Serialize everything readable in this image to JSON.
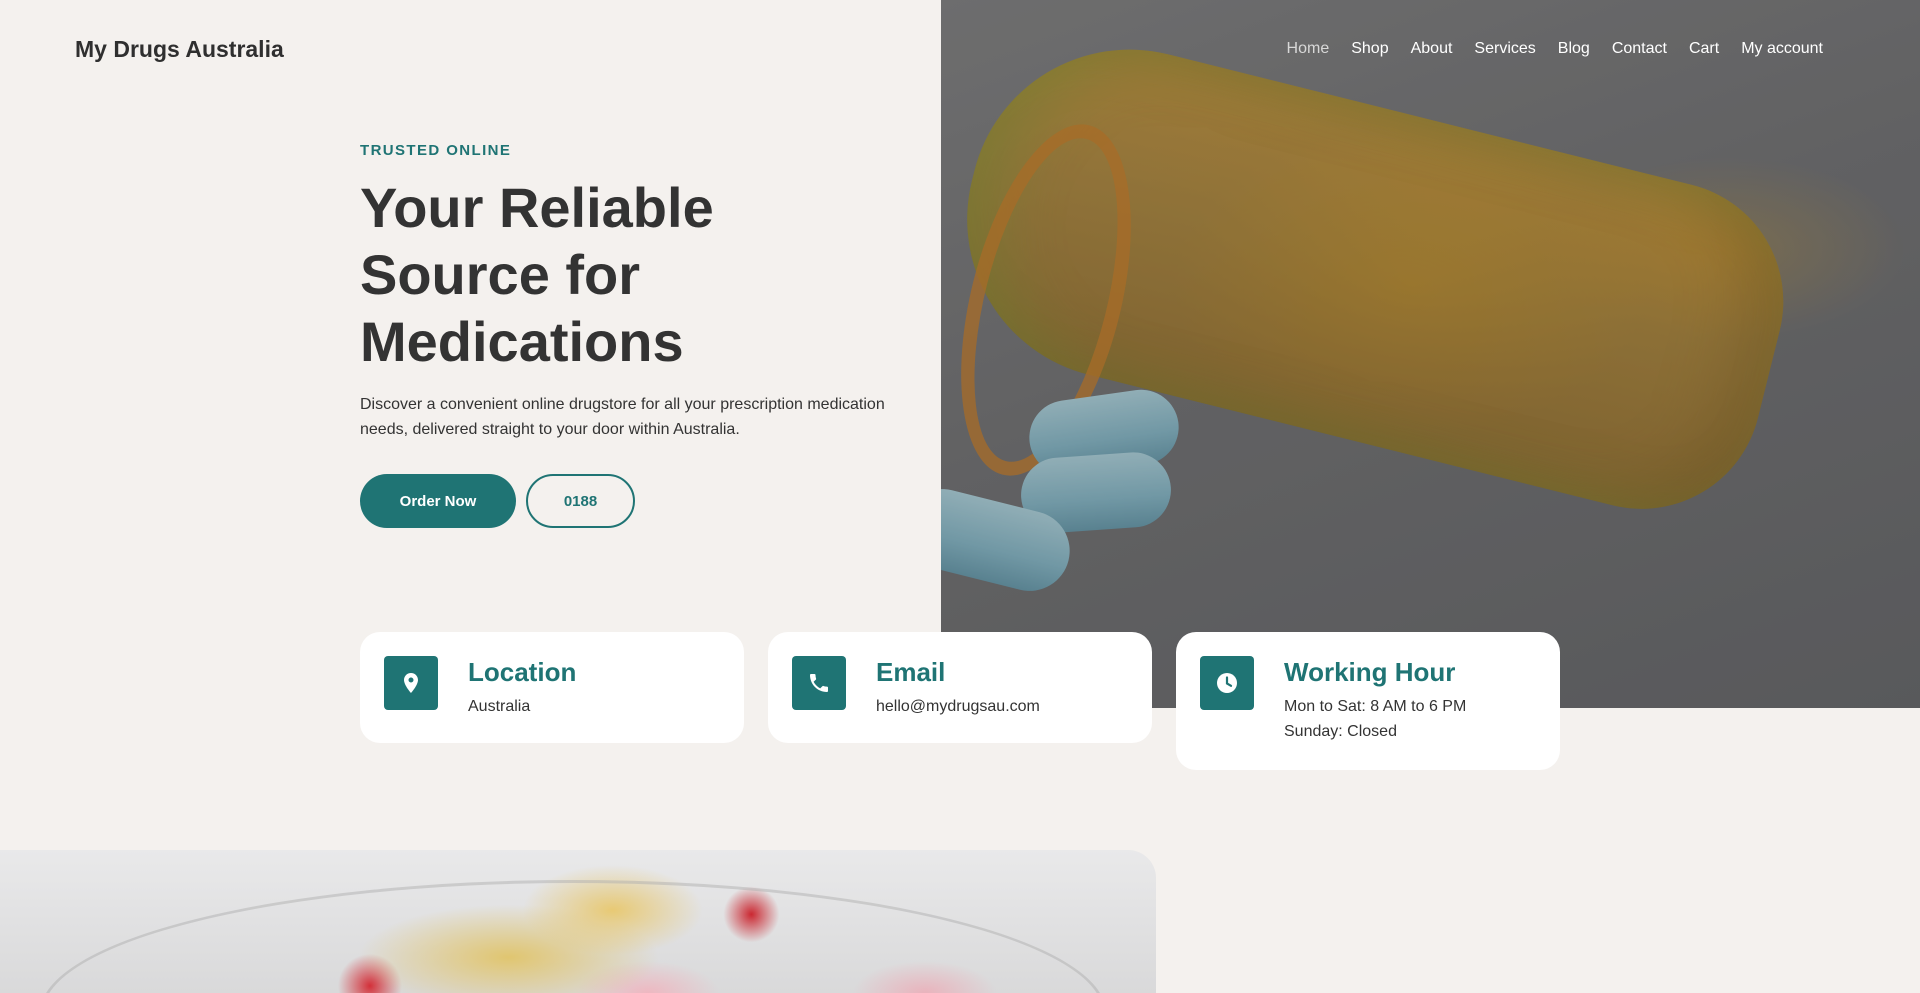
{
  "site": {
    "title": "My Drugs Australia"
  },
  "nav": {
    "items": [
      {
        "label": "Home",
        "active": true
      },
      {
        "label": "Shop"
      },
      {
        "label": "About"
      },
      {
        "label": "Services"
      },
      {
        "label": "Blog"
      },
      {
        "label": "Contact"
      },
      {
        "label": "Cart"
      },
      {
        "label": "My account"
      }
    ]
  },
  "hero": {
    "eyebrow": "TRUSTED ONLINE",
    "headline": "Your Reliable Source for Medications",
    "lead": "Discover a convenient online drugstore for all your prescription medication needs, delivered straight to your door within Australia.",
    "primary_button": "Order Now",
    "secondary_button": "0188"
  },
  "cards": [
    {
      "icon": "location-pin-icon",
      "title": "Location",
      "lines": [
        "Australia"
      ]
    },
    {
      "icon": "phone-icon",
      "title": "Email",
      "lines": [
        "hello@mydrugsau.com"
      ]
    },
    {
      "icon": "clock-icon",
      "title": "Working Hour",
      "lines": [
        "Mon to Sat: 8 AM to 6 PM",
        "Sunday: Closed"
      ]
    }
  ],
  "colors": {
    "accent": "#1f7474",
    "background": "#f4f1ee",
    "card": "#ffffff",
    "text": "#333333"
  }
}
